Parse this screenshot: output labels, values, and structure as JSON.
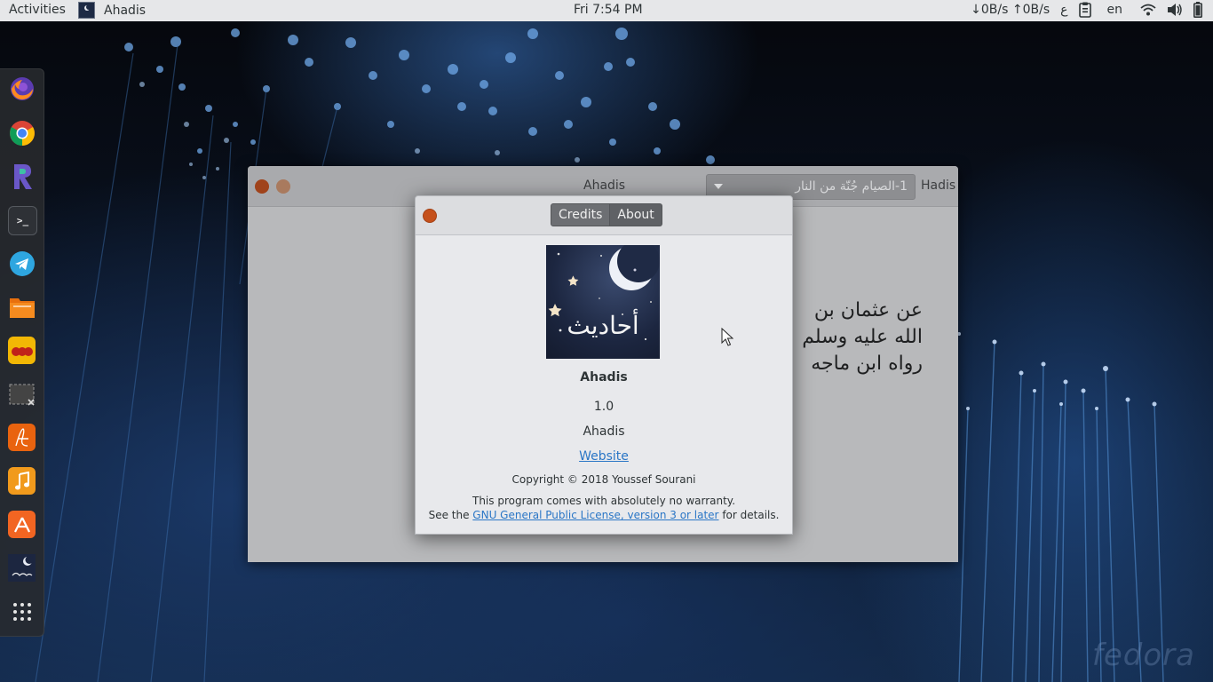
{
  "topbar": {
    "activities": "Activities",
    "app_name": "Ahadis",
    "clock": "Fri  7:54 PM",
    "netspeed": "↓0B/s ↑0B/s",
    "input_indicator": "ع",
    "language": "en"
  },
  "dock": {
    "items": [
      "firefox-icon",
      "chrome-icon",
      "rstudio-icon",
      "terminal-icon",
      "telegram-icon",
      "files-icon",
      "ball-app-icon",
      "screenshot-icon",
      "document-viewer-icon",
      "music-icon",
      "software-store-icon",
      "ahadis-icon",
      "show-apps-icon"
    ]
  },
  "main_window": {
    "title": "Ahadis",
    "hadis_label": "Hadis",
    "hadis_selected": "1-الصيام جُنّة من النار",
    "hadith_lines": [
      "عن عثمان بن                                         الله صلى",
      "الله عليه وسلم                                      م من القتال)",
      "رواه ابن ماجه"
    ]
  },
  "about_dialog": {
    "tab_credits": "Credits",
    "tab_about": "About",
    "logo_text": "أحاديث",
    "program_name": "Ahadis",
    "version": "1.0",
    "comments": "Ahadis",
    "website": "Website",
    "copyright": "Copyright © 2018 Youssef Sourani",
    "license_line1": "This program comes with absolutely no warranty.",
    "license_prefix": "See the ",
    "license_link": "GNU General Public License, version 3 or later",
    "license_suffix": " for details."
  },
  "desktop": {
    "watermark": "fedora"
  },
  "colors": {
    "topbar_bg": "#e6e7e9",
    "close_button": "#c5501b",
    "link": "#2a76c6",
    "dock_bg": "#28292d"
  }
}
